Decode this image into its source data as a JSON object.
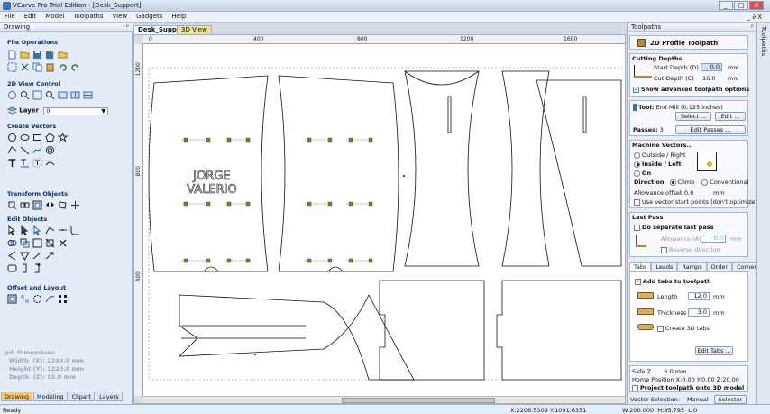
{
  "window": {
    "title": "VCarve Pro Trial Edition - [Desk_Support]",
    "min": "_",
    "max": "□",
    "close": "X"
  },
  "menu": [
    "File",
    "Edit",
    "Model",
    "Toolpaths",
    "View",
    "Gadgets",
    "Help"
  ],
  "menu_right": "_ ∂ X",
  "left": {
    "header": "Drawing",
    "pin": "ᵖ",
    "sections": {
      "file": "File Operations",
      "view2d": "2D View Control",
      "create": "Create Vectors",
      "transform": "Transform Objects",
      "edit": "Edit Objects",
      "offset": "Offset and Layout"
    },
    "layer_label": "Layer",
    "layer_value": "0",
    "job": {
      "title": "Job Dimensions",
      "width": "Width  (X): 2240.0 mm",
      "height": "Height (Y): 1220.0 mm",
      "depth": "Depth  (Z): 15.0 mm"
    },
    "tabs": [
      "Drawing",
      "Modeling",
      "Clipart",
      "Layers"
    ]
  },
  "doc_tabs": [
    "Desk_Support",
    "3D View"
  ],
  "ruler": {
    "top": [
      "0",
      "400",
      "800",
      "1200",
      "1600"
    ],
    "left": [
      "1200",
      "800",
      "400"
    ]
  },
  "canvas_text": {
    "line1": "JORGE",
    "line2": "VALERIO"
  },
  "toolpaths": {
    "header": "Toolpaths",
    "pin": "ᵖ",
    "title": "2D Profile Toolpath",
    "cutting_depths": "Cutting Depths",
    "start_depth_label": "Start Depth (D)",
    "start_depth_value": "0.0",
    "cut_depth_label": "Cut Depth (C)",
    "cut_depth_value": "16.0",
    "unit": "mm",
    "show_advanced": "Show advanced toolpath options",
    "tool_label": "Tool:",
    "tool_value": "End Mill (0.125 inches)",
    "select_btn": "Select ...",
    "edit_btn": "Edit ...",
    "passes_label": "Passes:",
    "passes_value": "3",
    "edit_passes_btn": "Edit Passes ...",
    "machine_vectors": "Machine Vectors...",
    "outside": "Outside / Right",
    "inside": "Inside / Left",
    "on": "On",
    "direction": "Direction",
    "climb": "Climb",
    "conventional": "Conventional",
    "allowance_label": "Allowance offset",
    "allowance_value": "0.0",
    "vector_start": "Use vector start points (don't optimize)",
    "last_pass": "Last Pass",
    "separate_last": "Do separate last pass",
    "allowance_a": "Allowance (A)",
    "allowance_a_value": "0.0",
    "reverse_dir": "Reverse direction",
    "tabs": [
      "Tabs",
      "Leads",
      "Ramps",
      "Order",
      "Corners"
    ],
    "add_tabs": "Add tabs to toolpath",
    "length_label": "Length",
    "length_value": "12.0",
    "thickness_label": "Thickness",
    "thickness_value": "3.0",
    "create_3d": "Create 3D tabs",
    "edit_tabs_btn": "Edit Tabs ...",
    "safe_z": "Safe Z       6.0 mm",
    "home": "Home Position  X:0.00 Y:0.00 Z:20.00",
    "project": "Project toolpath onto 3D model",
    "vector_sel_label": "Vector Selection:",
    "vector_sel_value": "Manual",
    "selector_btn": "Selector ..."
  },
  "sidestrip": "Toolpaths",
  "status": {
    "left": "Ready",
    "coords": "X:2206.5309 Y:1091.6351",
    "wh": "W:200.000  H:85.795  L:0"
  }
}
